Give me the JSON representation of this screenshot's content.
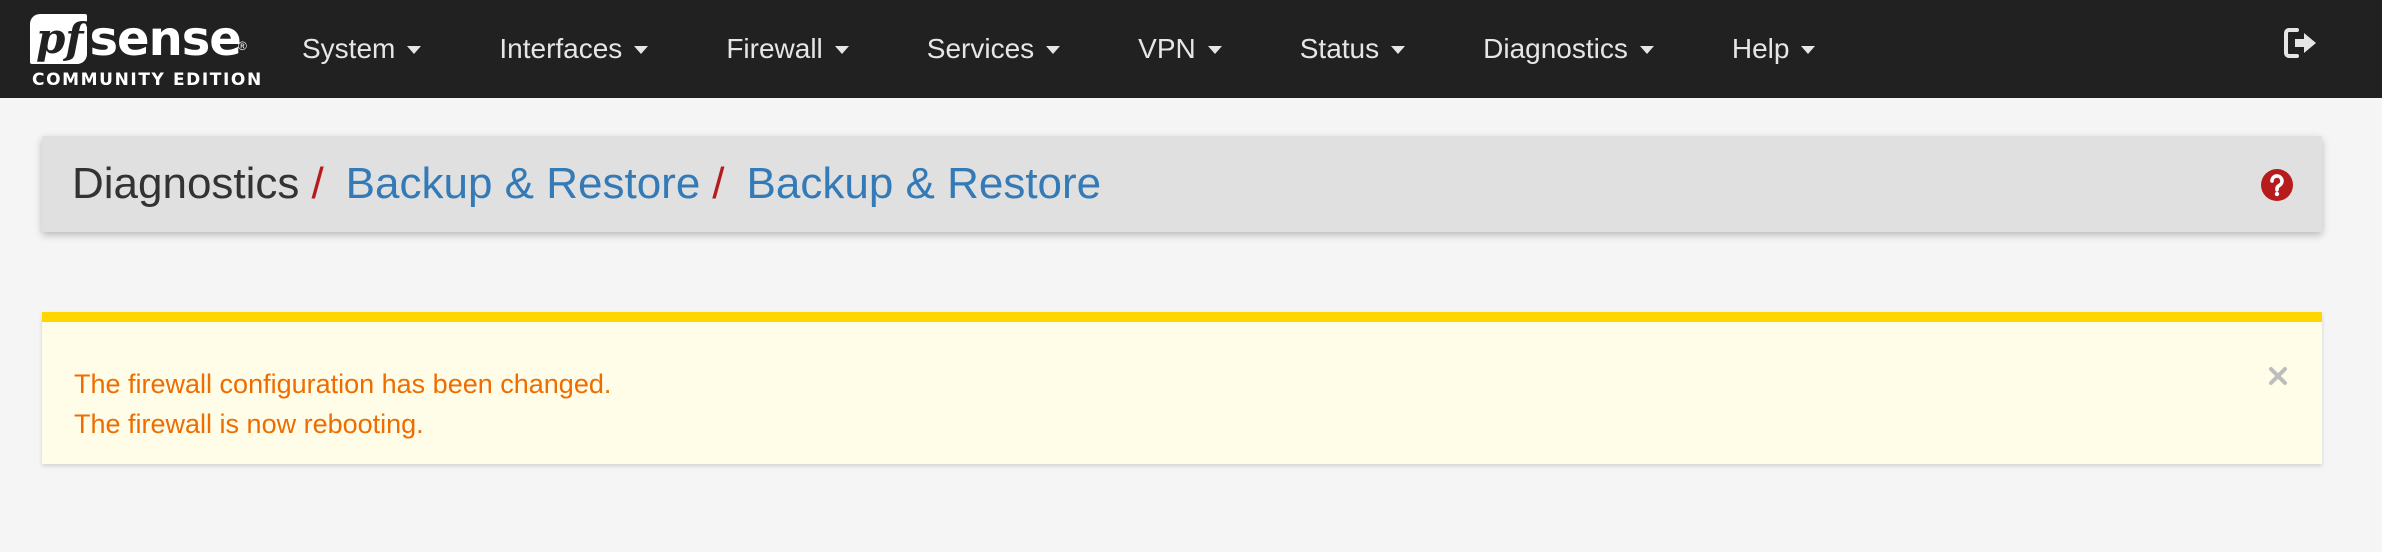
{
  "brand": {
    "logo_pf": "pf",
    "logo_sense": "sense",
    "registered": "®",
    "edition": "COMMUNITY EDITION"
  },
  "nav": {
    "items": [
      {
        "label": "System"
      },
      {
        "label": "Interfaces"
      },
      {
        "label": "Firewall"
      },
      {
        "label": "Services"
      },
      {
        "label": "VPN"
      },
      {
        "label": "Status"
      },
      {
        "label": "Diagnostics"
      },
      {
        "label": "Help"
      }
    ],
    "logout_icon": "sign-out-icon"
  },
  "breadcrumb": {
    "root": "Diagnostics",
    "separator": "/",
    "items": [
      {
        "label": "Backup & Restore"
      },
      {
        "label": "Backup & Restore"
      }
    ],
    "help_icon": "question-circle-icon"
  },
  "alert": {
    "lines": [
      "The firewall configuration has been changed.",
      "The firewall is now rebooting."
    ],
    "close_icon": "close-icon"
  },
  "colors": {
    "navbar_bg": "#212121",
    "page_bg": "#f5f5f5",
    "panel_bg": "#e0e0e0",
    "link": "#337ab7",
    "separator": "#b71c1c",
    "help_icon": "#b71c1c",
    "alert_bg": "#fffde7",
    "alert_border": "#ffd600",
    "alert_text": "#ef6c00"
  }
}
